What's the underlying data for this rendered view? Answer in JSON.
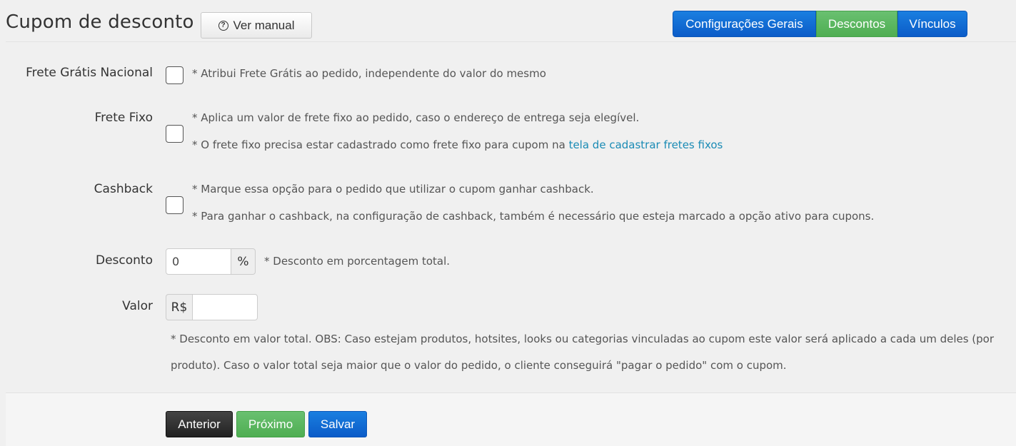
{
  "header": {
    "title": "Cupom de desconto",
    "manual_button": {
      "label": "Ver manual",
      "icon": "question-circle-icon"
    }
  },
  "tabs": [
    {
      "label": "Configurações Gerais",
      "color": "#0b5cc8",
      "active": false
    },
    {
      "label": "Descontos",
      "color": "#4fae52",
      "active": true
    },
    {
      "label": "Vínculos",
      "color": "#0b5cc8",
      "active": false
    }
  ],
  "form": {
    "frete_gratis": {
      "label": "Frete Grátis Nacional",
      "checked": false,
      "note": "* Atribui Frete Grátis ao pedido, independente do valor do mesmo"
    },
    "frete_fixo": {
      "label": "Frete Fixo",
      "checked": false,
      "note1": "* Aplica um valor de frete fixo ao pedido, caso o endereço de entrega seja elegível.",
      "note2_prefix": "* O frete fixo precisa estar cadastrado como frete fixo para cupom na",
      "note2_link": "tela de cadastrar fretes fixos"
    },
    "cashback": {
      "label": "Cashback",
      "checked": false,
      "note1": "* Marque essa opção para o pedido que utilizar o cupom ganhar cashback.",
      "note2": "* Para ganhar o cashback, na configuração de cashback, também é necessário que esteja marcado a opção ativo para cupons."
    },
    "desconto": {
      "label": "Desconto",
      "value": "0",
      "addon": "%",
      "note": "* Desconto em porcentagem total."
    },
    "valor": {
      "label": "Valor",
      "addon": "R$",
      "value": "",
      "note": "* Desconto em valor total. OBS: Caso estejam produtos, hotsites, looks ou categorias vinculadas ao cupom este valor será aplicado a cada um deles (por produto). Caso o valor total seja maior que o valor do pedido, o cliente conseguirá \"pagar o pedido\" com o cupom."
    }
  },
  "footer": {
    "previous_label": "Anterior",
    "next_label": "Próximo",
    "save_label": "Salvar"
  },
  "colors": {
    "primary": "#0b5cc8",
    "success": "#4fae52",
    "dark": "#222222",
    "link": "#1a8bb5"
  }
}
